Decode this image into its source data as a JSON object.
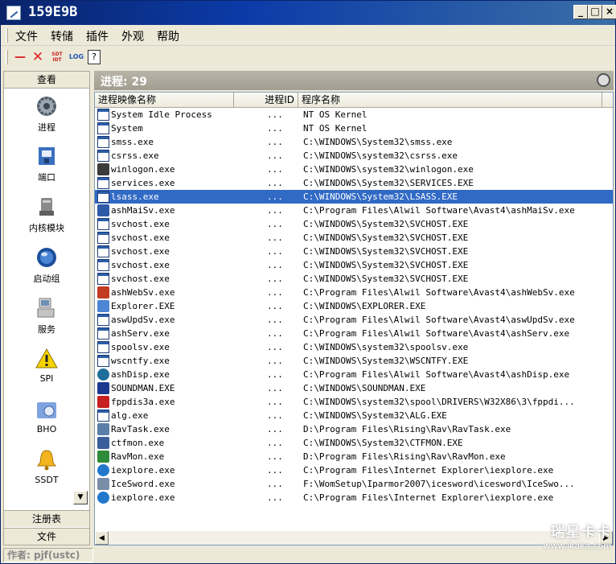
{
  "window": {
    "title": "159E9B",
    "min": "_",
    "max": "□",
    "close": "×"
  },
  "menu": [
    "文件",
    "转储",
    "插件",
    "外观",
    "帮助"
  ],
  "toolbar": {
    "dash": "—",
    "x": "✕",
    "sdt": "SDT IDT",
    "log": "LOG",
    "help": "?"
  },
  "sidebar": {
    "header": "查看",
    "items": [
      {
        "label": "进程",
        "icon": "gear-icon"
      },
      {
        "label": "端口",
        "icon": "network-port-icon"
      },
      {
        "label": "内核模块",
        "icon": "disk-module-icon"
      },
      {
        "label": "启动组",
        "icon": "globe-icon"
      },
      {
        "label": "服务",
        "icon": "computer-service-icon"
      },
      {
        "label": "SPI",
        "icon": "warning-icon"
      },
      {
        "label": "BHO",
        "icon": "folder-browser-icon"
      },
      {
        "label": "SSDT",
        "icon": "bell-icon"
      }
    ],
    "scroll_down": "▼",
    "footer1": "注册表",
    "footer2": "文件"
  },
  "status": {
    "count_label": "进程: 29"
  },
  "columns": [
    "进程映像名称",
    "进程ID",
    "程序名称"
  ],
  "rows": [
    {
      "name": "System Idle Process",
      "pid": "...",
      "path": "NT OS Kernel",
      "icon": "window-icon"
    },
    {
      "name": "System",
      "pid": "...",
      "path": "NT OS Kernel",
      "icon": "window-icon"
    },
    {
      "name": "smss.exe",
      "pid": "...",
      "path": "C:\\WINDOWS\\System32\\smss.exe",
      "icon": "window-icon"
    },
    {
      "name": "csrss.exe",
      "pid": "...",
      "path": "C:\\WINDOWS\\system32\\csrss.exe",
      "icon": "window-icon"
    },
    {
      "name": "winlogon.exe",
      "pid": "...",
      "path": "C:\\WINDOWS\\system32\\winlogon.exe",
      "icon": "lock-icon"
    },
    {
      "name": "services.exe",
      "pid": "...",
      "path": "C:\\WINDOWS\\System32\\SERVICES.EXE",
      "icon": "window-icon"
    },
    {
      "name": "lsass.exe",
      "pid": "...",
      "path": "C:\\WINDOWS\\System32\\LSASS.EXE",
      "icon": "window-icon",
      "selected": true
    },
    {
      "name": "ashMaiSv.exe",
      "pid": "...",
      "path": "C:\\Program Files\\Alwil Software\\Avast4\\ashMaiSv.exe",
      "icon": "mail-icon"
    },
    {
      "name": "svchost.exe",
      "pid": "...",
      "path": "C:\\WINDOWS\\System32\\SVCHOST.EXE",
      "icon": "window-icon"
    },
    {
      "name": "svchost.exe",
      "pid": "...",
      "path": "C:\\WINDOWS\\System32\\SVCHOST.EXE",
      "icon": "window-icon"
    },
    {
      "name": "svchost.exe",
      "pid": "...",
      "path": "C:\\WINDOWS\\System32\\SVCHOST.EXE",
      "icon": "window-icon"
    },
    {
      "name": "svchost.exe",
      "pid": "...",
      "path": "C:\\WINDOWS\\System32\\SVCHOST.EXE",
      "icon": "window-icon"
    },
    {
      "name": "svchost.exe",
      "pid": "...",
      "path": "C:\\WINDOWS\\System32\\SVCHOST.EXE",
      "icon": "window-icon"
    },
    {
      "name": "ashWebSv.exe",
      "pid": "...",
      "path": "C:\\Program Files\\Alwil Software\\Avast4\\ashWebSv.exe",
      "icon": "web-shield-icon"
    },
    {
      "name": "Explorer.EXE",
      "pid": "...",
      "path": "C:\\WINDOWS\\EXPLORER.EXE",
      "icon": "explorer-icon"
    },
    {
      "name": "aswUpdSv.exe",
      "pid": "...",
      "path": "C:\\Program Files\\Alwil Software\\Avast4\\aswUpdSv.exe",
      "icon": "window-icon"
    },
    {
      "name": "ashServ.exe",
      "pid": "...",
      "path": "C:\\Program Files\\Alwil Software\\Avast4\\ashServ.exe",
      "icon": "window-icon"
    },
    {
      "name": "spoolsv.exe",
      "pid": "...",
      "path": "C:\\WINDOWS\\system32\\spoolsv.exe",
      "icon": "window-icon"
    },
    {
      "name": "wscntfy.exe",
      "pid": "...",
      "path": "C:\\WINDOWS\\System32\\WSCNTFY.EXE",
      "icon": "window-icon"
    },
    {
      "name": "ashDisp.exe",
      "pid": "...",
      "path": "C:\\Program Files\\Alwil Software\\Avast4\\ashDisp.exe",
      "icon": "avast-icon"
    },
    {
      "name": "SOUNDMAN.EXE",
      "pid": "...",
      "path": "C:\\WINDOWS\\SOUNDMAN.EXE",
      "icon": "sound-icon"
    },
    {
      "name": "fppdis3a.exe",
      "pid": "...",
      "path": "C:\\WINDOWS\\system32\\spool\\DRIVERS\\W32X86\\3\\fppdi...",
      "icon": "pdf-icon"
    },
    {
      "name": "alg.exe",
      "pid": "...",
      "path": "C:\\WINDOWS\\System32\\ALG.EXE",
      "icon": "window-icon"
    },
    {
      "name": "RavTask.exe",
      "pid": "...",
      "path": "D:\\Program Files\\Rising\\Rav\\RavTask.exe",
      "icon": "task-icon"
    },
    {
      "name": "ctfmon.exe",
      "pid": "...",
      "path": "C:\\WINDOWS\\System32\\CTFMON.EXE",
      "icon": "pen-icon"
    },
    {
      "name": "RavMon.exe",
      "pid": "...",
      "path": "D:\\Program Files\\Rising\\Rav\\RavMon.exe",
      "icon": "tree-icon"
    },
    {
      "name": "iexplore.exe",
      "pid": "...",
      "path": "C:\\Program Files\\Internet Explorer\\iexplore.exe",
      "icon": "ie-icon"
    },
    {
      "name": "IceSword.exe",
      "pid": "...",
      "path": "F:\\WomSetup\\Iparmor2007\\icesword\\icesword\\IceSwo...",
      "icon": "sword-icon"
    },
    {
      "name": "iexplore.exe",
      "pid": "...",
      "path": "C:\\Program Files\\Internet Explorer\\iexplore.exe",
      "icon": "ie-icon"
    }
  ],
  "scroll": {
    "left": "◀",
    "right": "▶"
  },
  "author": "作者: pjf(ustc)",
  "watermark": {
    "line1": "瑞星卡卡",
    "line2": "www.ikaka.com"
  }
}
